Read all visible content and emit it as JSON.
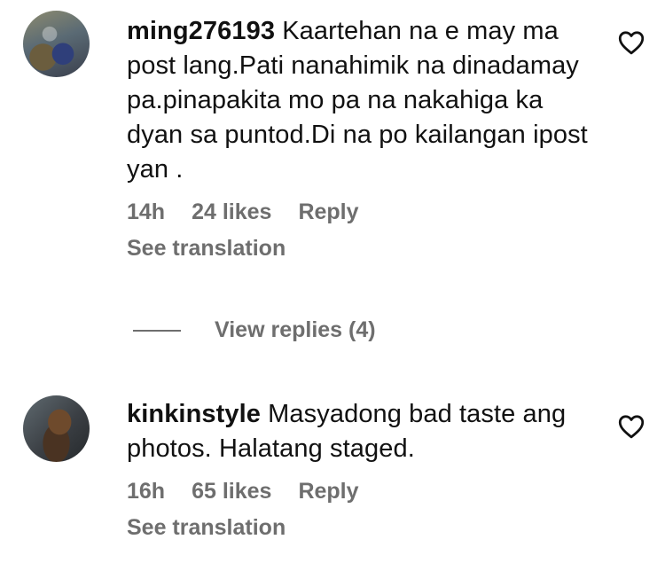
{
  "comments": [
    {
      "username": "ming276193",
      "text": "Kaartehan na e may ma post lang.Pati nanahimik na dinadamay pa.pinapakita mo pa na nakahiga ka dyan sa puntod.Di na po kailangan ipost yan .",
      "time": "14h",
      "likes": "24 likes",
      "reply_label": "Reply",
      "see_translation": "See translation",
      "avatar_icon": "user-avatar",
      "heart_icon": "heart-outline-icon"
    },
    {
      "username": "kinkinstyle",
      "text": "Masyadong bad taste ang photos. Halatang staged.",
      "time": "16h",
      "likes": "65 likes",
      "reply_label": "Reply",
      "see_translation": "See translation",
      "avatar_icon": "user-avatar",
      "heart_icon": "heart-outline-icon"
    }
  ],
  "view_replies": "View replies (4)",
  "colors": {
    "text": "#111111",
    "meta": "#6e6e6e",
    "background": "#ffffff"
  }
}
